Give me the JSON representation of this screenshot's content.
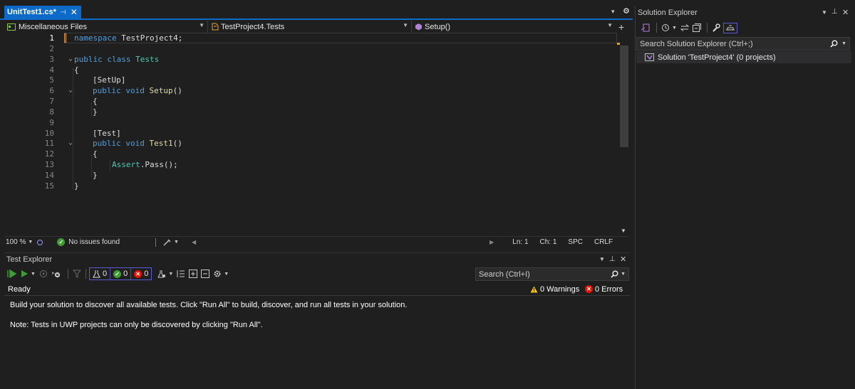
{
  "editor_tab": {
    "title": "UnitTest1.cs*",
    "pin_glyph": "⊣",
    "close_glyph": "✕"
  },
  "window_controls": {
    "dropdown": "▾",
    "settings": "✦",
    "split": "+"
  },
  "navbar": {
    "project": "Miscellaneous Files",
    "type": "TestProject4.Tests",
    "member": "Setup()"
  },
  "code_lines": [
    {
      "n": "1",
      "text": "namespace TestProject4;"
    },
    {
      "n": "2",
      "text": ""
    },
    {
      "n": "3",
      "text": "public class Tests"
    },
    {
      "n": "4",
      "text": "{"
    },
    {
      "n": "5",
      "text": "[SetUp]"
    },
    {
      "n": "6",
      "text": "public void Setup()"
    },
    {
      "n": "7",
      "text": "{"
    },
    {
      "n": "8",
      "text": "}"
    },
    {
      "n": "9",
      "text": ""
    },
    {
      "n": "10",
      "text": "[Test]"
    },
    {
      "n": "11",
      "text": "public void Test1()"
    },
    {
      "n": "12",
      "text": "{"
    },
    {
      "n": "13",
      "text": "Assert.Pass();"
    },
    {
      "n": "14",
      "text": "}"
    },
    {
      "n": "15",
      "text": "}"
    }
  ],
  "code_tokens": {
    "namespace_kw": "namespace",
    "namespace_name": " TestProject4;",
    "public_kw": "public",
    "class_kw": "class",
    "class_name": "Tests",
    "void_kw": "void",
    "setup_fn": "Setup",
    "test1_fn": "Test1",
    "parens": "()",
    "setup_attr": "[SetUp]",
    "test_attr": "[Test]",
    "open_brace": "{",
    "close_brace": "}",
    "assert_cls": "Assert",
    "pass_call": ".Pass();"
  },
  "status_bar": {
    "zoom": "100 %",
    "issues": "No issues found",
    "line": "Ln: 1",
    "col": "Ch: 1",
    "whitespace": "SPC",
    "line_ending": "CRLF"
  },
  "test_explorer": {
    "title": "Test Explorer",
    "search_placeholder": "Search (Ctrl+I)",
    "counts": {
      "total": "0",
      "passed": "0",
      "failed": "0"
    },
    "status": "Ready",
    "warnings": "0 Warnings",
    "errors": "0 Errors",
    "message1": "Build your solution to discover all available tests. Click \"Run All\" to build, discover, and run all tests in your solution.",
    "message2": "Note: Tests in UWP projects can only be discovered by clicking \"Run All\"."
  },
  "solution_explorer": {
    "title": "Solution Explorer",
    "search_placeholder": "Search Solution Explorer (Ctrl+;)",
    "solution_item": "Solution 'TestProject4' (0 projects)"
  },
  "colors": {
    "accent": "#0e6ac9",
    "keyword": "#569cd6",
    "type": "#4ec9b0",
    "method": "#dcdcaa",
    "ok_green": "#3f9c35",
    "error_red": "#e51400",
    "warning_yellow": "#f0c419"
  }
}
